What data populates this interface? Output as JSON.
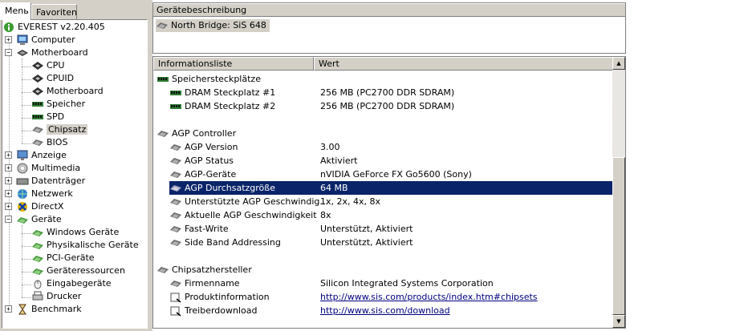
{
  "tabs": {
    "menu": "Menь",
    "favorites": "Favoriten"
  },
  "tree": [
    {
      "label": "EVEREST v2.20.405",
      "icon": "info-icon"
    },
    {
      "label": "Computer",
      "icon": "computer-icon"
    },
    {
      "label": "Motherboard",
      "icon": "motherboard-icon"
    },
    {
      "label": "CPU",
      "icon": "chip-icon"
    },
    {
      "label": "CPUID",
      "icon": "chip-icon"
    },
    {
      "label": "Motherboard",
      "icon": "chip-icon"
    },
    {
      "label": "Speicher",
      "icon": "memory-icon"
    },
    {
      "label": "SPD",
      "icon": "memory-icon"
    },
    {
      "label": "Chipsatz",
      "icon": "chip-icon"
    },
    {
      "label": "BIOS",
      "icon": "chip-icon"
    },
    {
      "label": "Anzeige",
      "icon": "display-icon"
    },
    {
      "label": "Multimedia",
      "icon": "multimedia-icon"
    },
    {
      "label": "Datenträger",
      "icon": "disk-icon"
    },
    {
      "label": "Netzwerk",
      "icon": "network-icon"
    },
    {
      "label": "DirectX",
      "icon": "directx-icon"
    },
    {
      "label": "Geräte",
      "icon": "devices-icon"
    },
    {
      "label": "Windows Geräte",
      "icon": "device-icon"
    },
    {
      "label": "Physikalische Geräte",
      "icon": "device-icon"
    },
    {
      "label": "PCI-Geräte",
      "icon": "device-icon"
    },
    {
      "label": "Geräteressourcen",
      "icon": "device-icon"
    },
    {
      "label": "Eingabegeräte",
      "icon": "mouse-icon"
    },
    {
      "label": "Drucker",
      "icon": "printer-icon"
    },
    {
      "label": "Benchmark",
      "icon": "hourglass-icon"
    }
  ],
  "device_description": {
    "header": "Gerätebeschreibung",
    "item": "North Bridge: SiS 648"
  },
  "info_list": {
    "col_field": "Informationsliste",
    "col_value": "Wert",
    "rows": [
      {
        "label": "Speichersteckplätze",
        "value": ""
      },
      {
        "label": "DRAM Steckplatz #1",
        "value": "256 MB  (PC2700 DDR SDRAM)"
      },
      {
        "label": "DRAM Steckplatz #2",
        "value": "256 MB  (PC2700 DDR SDRAM)"
      },
      {
        "label": "AGP Controller",
        "value": ""
      },
      {
        "label": "AGP Version",
        "value": "3.00"
      },
      {
        "label": "AGP Status",
        "value": "Aktiviert"
      },
      {
        "label": "AGP-Geräte",
        "value": "nVIDIA GeForce FX Go5600 (Sony)"
      },
      {
        "label": "AGP Durchsatzgröße",
        "value": "64 MB"
      },
      {
        "label": "Unterstützte AGP Geschwindig...",
        "value": "1x, 2x, 4x, 8x"
      },
      {
        "label": "Aktuelle AGP Geschwindigkeit",
        "value": "8x"
      },
      {
        "label": "Fast-Write",
        "value": "Unterstützt, Aktiviert"
      },
      {
        "label": "Side Band Addressing",
        "value": "Unterstützt, Aktiviert"
      },
      {
        "label": "Chipsatzhersteller",
        "value": ""
      },
      {
        "label": "Firmenname",
        "value": "Silicon Integrated Systems Corporation"
      },
      {
        "label": "Produktinformation",
        "value": "http://www.sis.com/products/index.htm#chipsets"
      },
      {
        "label": "Treiberdownload",
        "value": "http://www.sis.com/download"
      }
    ]
  },
  "scrollbar": {
    "up": "▲",
    "down": "▼"
  }
}
